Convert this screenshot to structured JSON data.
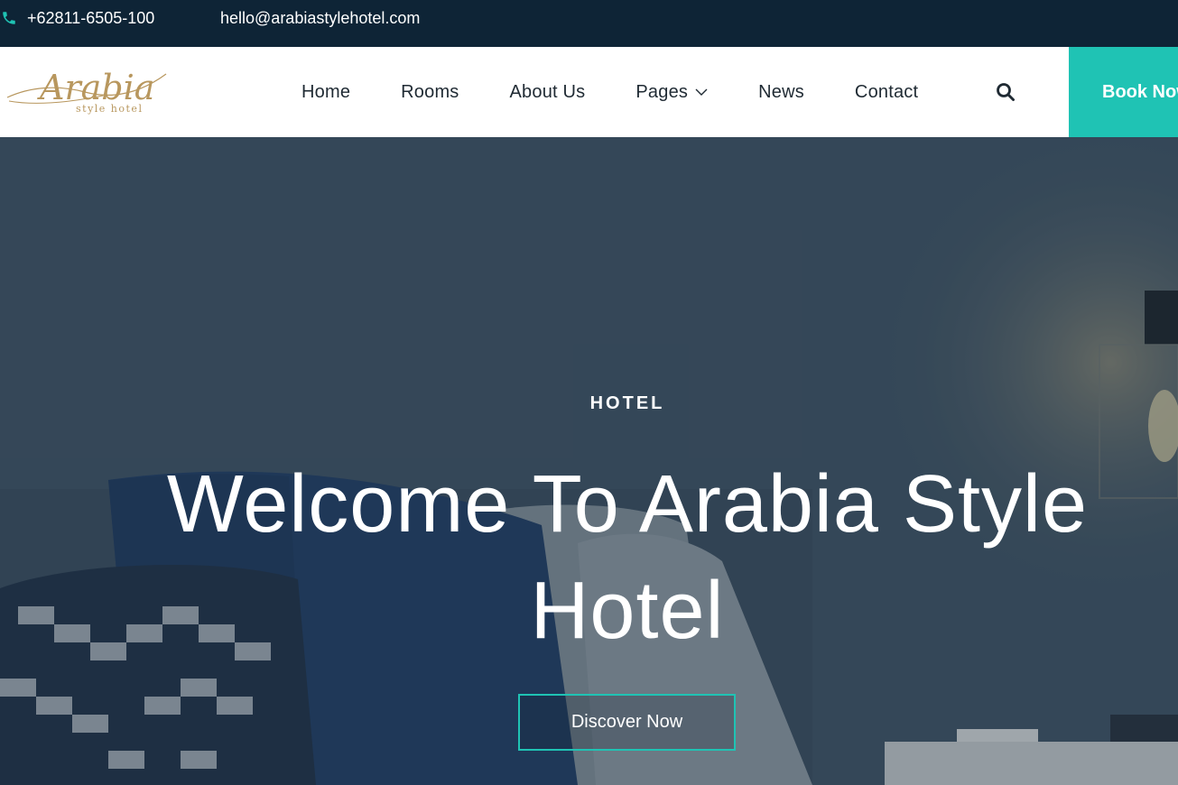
{
  "topbar": {
    "phone": "+62811-6505-100",
    "email": "hello@arabiastylehotel.com",
    "phone_icon": "phone-icon",
    "icon_color": "#1fc3b4"
  },
  "logo": {
    "brand": "Arabia",
    "tagline": "style hotel",
    "color": "#b8975e"
  },
  "nav": {
    "items": [
      {
        "label": "Home"
      },
      {
        "label": "Rooms"
      },
      {
        "label": "About Us"
      },
      {
        "label": "Pages",
        "has_dropdown": true
      },
      {
        "label": "News"
      },
      {
        "label": "Contact"
      }
    ],
    "search_icon": "search-icon",
    "book_label": "Book Now"
  },
  "hero": {
    "subtitle": "HOTEL",
    "title": "Welcome To Arabia Style Hotel",
    "cta_label": "Discover Now"
  },
  "colors": {
    "accent": "#1fc3b4",
    "topbar_bg": "#0e2436",
    "nav_text": "#1f2a33"
  }
}
